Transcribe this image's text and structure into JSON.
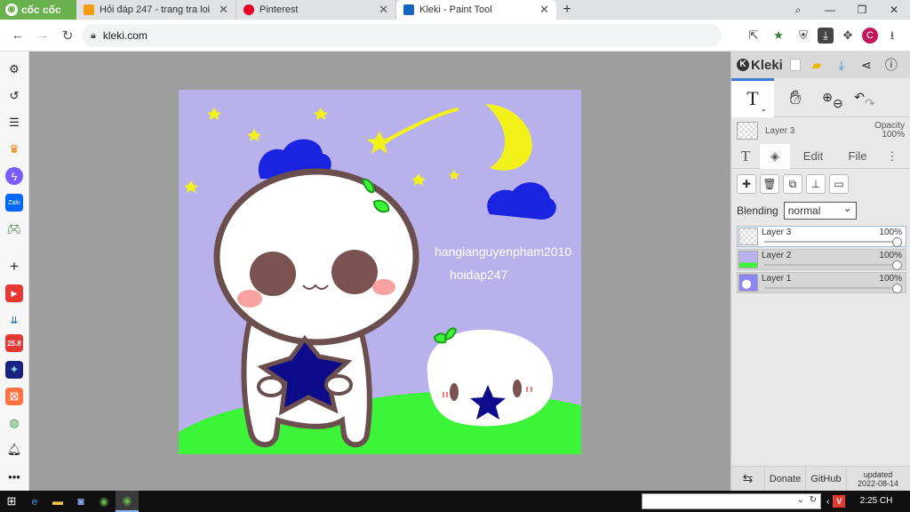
{
  "browser": {
    "brand": "cốc cốc",
    "tabs": [
      {
        "title": "Hỏi đáp 247 - trang tra loi",
        "fav_color": "#f39c12",
        "active": false
      },
      {
        "title": "Pinterest",
        "fav_color": "#e60023",
        "active": false
      },
      {
        "title": "Kleki - Paint Tool",
        "fav_color": "#1565c0",
        "active": true
      }
    ],
    "new_tab": "+",
    "url": "kleki.com"
  },
  "sidebar": {
    "icons": [
      "settings-icon",
      "history-icon",
      "list-icon",
      "crown-icon",
      "messenger-icon",
      "zalo-icon",
      "game-icon",
      "add-icon",
      "youtube-icon",
      "download-icon",
      "calendar-icon",
      "game-cover-icon",
      "bonus-icon",
      "maps-icon",
      "bell-icon",
      "more-icon"
    ],
    "calendar_label": "25.8",
    "zalo_label": "Zalo"
  },
  "canvas": {
    "background": "#b9b1ec",
    "watermark_line1": "hangianguyenpham2010",
    "watermark_line2": "hoidap247"
  },
  "kleki": {
    "logo": "Kleki",
    "layer_label": "Layer 3",
    "opacity_label": "Opacity",
    "opacity_value": "100%",
    "tabs": {
      "edit": "Edit",
      "file": "File"
    },
    "blending_label": "Blending",
    "blending_value": "normal",
    "layers": [
      {
        "name": "Layer 3",
        "opacity": "100%",
        "selected": true
      },
      {
        "name": "Layer 2",
        "opacity": "100%",
        "selected": false
      },
      {
        "name": "Layer 1",
        "opacity": "100%",
        "selected": false
      }
    ],
    "footer": {
      "donate": "Donate",
      "github": "GitHub",
      "updated_label": "updated",
      "updated_date": "2022-08-14"
    }
  },
  "taskbar": {
    "time": "2:25 CH",
    "tray_badge": "V"
  }
}
